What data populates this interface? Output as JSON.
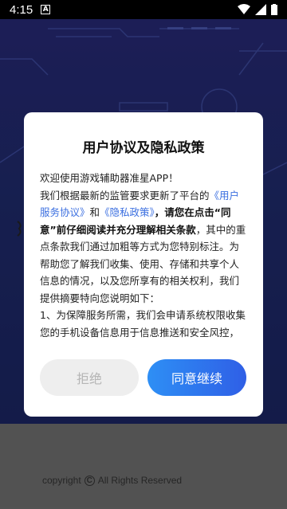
{
  "status_bar": {
    "time": "4:15",
    "notification_icon": "A"
  },
  "dialog": {
    "title": "用户协议及隐私政策",
    "lines": {
      "l1": "欢迎使用游戏辅助器准星APP！",
      "l2a": "我们根据最新的监管要求更新了平台的",
      "link1": "《用户服务协议》",
      "l2b": "和",
      "link2": "《隐私政策》",
      "bold1": "，请您在点击“同意”前仔细阅读并充分理解相关条款",
      "l3": "，其中的重点条款我们通过加粗等方式为您特别标注。为帮助您了解我们收集、使用、存储和共享个人信息的情况，以及您所享有的相关权利，我们提供摘要特向您说明如下：",
      "l4": "1、为保障服务所需，我们会申请系统权限收集您的手机设备信息用于信息推送和安全风控，并申"
    },
    "reject_label": "拒绝",
    "agree_label": "同意继续"
  },
  "footer": {
    "copyright_prefix": "copyright",
    "copyright_symbol": "C",
    "copyright_text": "All Rights Reserved"
  },
  "colors": {
    "link": "#3b6fe0",
    "agree_start": "#2e8ff5",
    "agree_end": "#2f5fe6"
  }
}
